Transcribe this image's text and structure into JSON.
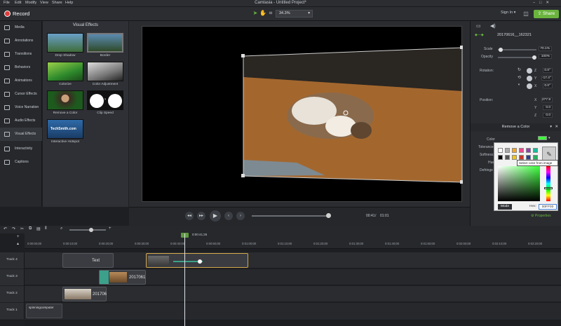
{
  "menu": [
    "File",
    "Edit",
    "Modify",
    "View",
    "Share",
    "Help"
  ],
  "window_title": "Camtasia - Untitled Project*",
  "toolbar": {
    "record_label": "Record",
    "zoom": "34.3%",
    "sign_in": "Sign In",
    "share_label": "Share"
  },
  "sidebar": {
    "items": [
      {
        "label": "Media",
        "icon": "film-icon"
      },
      {
        "label": "Annotations",
        "icon": "annotation-icon"
      },
      {
        "label": "Transitions",
        "icon": "transition-icon"
      },
      {
        "label": "Behaviors",
        "icon": "behavior-icon"
      },
      {
        "label": "Animations",
        "icon": "animation-icon"
      },
      {
        "label": "Cursor Effects",
        "icon": "cursor-icon"
      },
      {
        "label": "Voice Narration",
        "icon": "microphone-icon"
      },
      {
        "label": "Audio Effects",
        "icon": "audio-icon"
      },
      {
        "label": "Visual Effects",
        "icon": "visual-effects-icon"
      },
      {
        "label": "Interactivity",
        "icon": "interactivity-icon"
      },
      {
        "label": "Captions",
        "icon": "captions-icon"
      }
    ]
  },
  "library": {
    "title": "Visual Effects",
    "effects": [
      "Drop Shadow",
      "Border",
      "Colorize",
      "Color Adjustment",
      "Remove a Color",
      "Clip Speed",
      "Interactive Hotspot"
    ],
    "hotspot_thumb_text": "TechSmith.com"
  },
  "player": {
    "current_time": "00:41",
    "total_time": "01:01"
  },
  "properties": {
    "clip_name": "20170616__162321",
    "scale_label": "Scale",
    "scale_value": "70.1%",
    "scale_fraction": 0.7,
    "opacity_label": "Opacity",
    "opacity_value": "100%",
    "opacity_fraction": 1.0,
    "rotation_label": "Rotation:",
    "rot_z": "0.0°",
    "rot_y": "-17.4°",
    "rot_x": "0.0°",
    "axis_z": "Z",
    "axis_y": "Y",
    "axis_x": "X",
    "position_label": "Position:",
    "pos_x": "277.9",
    "pos_y": "0.0",
    "pos_z": "0.0"
  },
  "remove_color": {
    "title": "Remove a Color",
    "color_label": "Color",
    "tolerance_label": "Tolerance",
    "softness_label": "Softness",
    "hue_label": "Hue",
    "defringe_label": "Defringe",
    "tooltip": "Select color from image",
    "mode_label": "Mode",
    "hex_label": "Hex:",
    "hex_value": "00FF00",
    "properties_button": "Properties",
    "selected_color": "#3cff3c"
  },
  "timeline": {
    "playhead_time": "0:00:41;26",
    "ticks": [
      "0:00:00;00",
      "0:00:10;00",
      "0:00:20;00",
      "0:00:30;00",
      "0:00:40;00",
      "0:00:50;00",
      "0:01:00;00",
      "0:01:10;00",
      "0:01:20;00",
      "0:01:30;00",
      "0:01:40;00",
      "0:01:50;00",
      "0:02:00;00",
      "0:02:10;00",
      "0:02:20;00"
    ],
    "tracks": [
      {
        "name": "Track 4",
        "clips": [
          {
            "label": "Text"
          },
          {
            "label": ""
          }
        ]
      },
      {
        "name": "Track 3",
        "clips": [
          {
            "label": "2017061"
          }
        ]
      },
      {
        "name": "Track 2",
        "clips": [
          {
            "label": "201706"
          }
        ]
      },
      {
        "name": "Track 1",
        "clips": [
          {
            "label": "spinningcomputer"
          }
        ]
      }
    ]
  },
  "colors": {
    "accent": "#6ab43e",
    "record": "#e23b3b",
    "clip_selected": "#d4a84b"
  }
}
